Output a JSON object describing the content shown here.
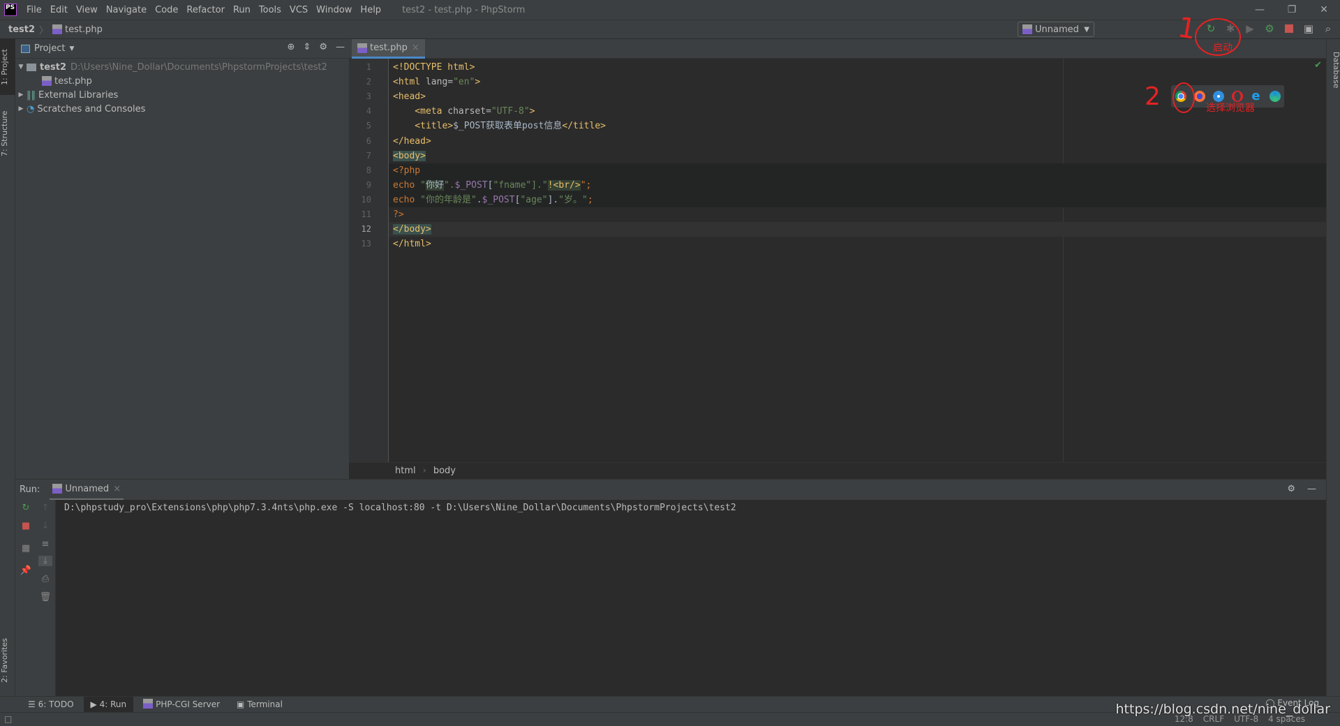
{
  "window": {
    "title": "test2 - test.php - PhpStorm",
    "logo": "PS",
    "controls": [
      "—",
      "❐",
      "✕"
    ]
  },
  "menu": [
    "File",
    "Edit",
    "View",
    "Navigate",
    "Code",
    "Refactor",
    "Run",
    "Tools",
    "VCS",
    "Window",
    "Help"
  ],
  "navbar": {
    "project": "test2",
    "file": "test.php"
  },
  "toolbar": {
    "run_config": "Unnamed",
    "icons": [
      "rerun-icon",
      "debug-icon",
      "coverage-icon",
      "profile-icon",
      "stop-icon",
      "terminal-icon",
      "search-icon"
    ]
  },
  "left_stripe": {
    "project": "1: Project",
    "structure": "7: Structure",
    "favorites": "2: Favorites"
  },
  "right_stripe": {
    "database": "Database"
  },
  "project_panel": {
    "title": "Project",
    "tree": [
      {
        "label": "test2",
        "path": "D:\\Users\\Nine_Dollar\\Documents\\PhpstormProjects\\test2"
      },
      {
        "label": "test.php"
      },
      {
        "label": "External Libraries"
      },
      {
        "label": "Scratches and Consoles"
      }
    ]
  },
  "editor": {
    "tab": "test.php",
    "current_line": 12,
    "lines": [
      [
        [
          "<!DOCTYPE html>",
          "tag"
        ]
      ],
      [
        [
          "<html ",
          "tag"
        ],
        [
          "lang=",
          "attr"
        ],
        [
          "\"en\"",
          "str"
        ],
        [
          ">",
          "tag"
        ]
      ],
      [
        [
          "<head>",
          "tag"
        ]
      ],
      [
        [
          "    <meta ",
          "tag"
        ],
        [
          "charset=",
          "attr"
        ],
        [
          "\"UTF-8\"",
          "str"
        ],
        [
          ">",
          "tag"
        ]
      ],
      [
        [
          "    <title>",
          "tag"
        ],
        [
          "$_POST获取表单post信息",
          "txt"
        ],
        [
          "</title>",
          "tag"
        ]
      ],
      [
        [
          "</head>",
          "tag"
        ]
      ],
      [
        [
          "<body>",
          "tag hlg"
        ]
      ],
      [
        [
          "<?php",
          "kw"
        ]
      ],
      [
        [
          "echo ",
          "kw"
        ],
        [
          "\"",
          "str"
        ],
        [
          "你好",
          "txt hl"
        ],
        [
          "\".",
          "str"
        ],
        [
          "$_POST",
          "var"
        ],
        [
          "[",
          "txt"
        ],
        [
          "\"fname\"",
          "str"
        ],
        [
          "].\"",
          "str"
        ],
        [
          "!<br/>",
          "tag hl"
        ],
        [
          "\";",
          "kw"
        ]
      ],
      [
        [
          "echo ",
          "kw"
        ],
        [
          "\"你的年龄是\"",
          "str"
        ],
        [
          ".",
          "txt"
        ],
        [
          "$_POST",
          "var"
        ],
        [
          "[",
          "txt"
        ],
        [
          "\"age\"",
          "str"
        ],
        [
          "].",
          "txt"
        ],
        [
          "\"岁。\"",
          "str"
        ],
        [
          ";",
          "kw"
        ]
      ],
      [
        [
          "?>",
          "kw"
        ]
      ],
      [
        [
          "</body>",
          "tag hlg"
        ]
      ],
      [
        [
          "</html>",
          "tag"
        ]
      ]
    ],
    "breadcrumbs": [
      "html",
      "body"
    ]
  },
  "browsers": [
    "chrome",
    "firefox",
    "safari",
    "opera",
    "ie",
    "edge"
  ],
  "annotations": {
    "one": "1",
    "start": "启动",
    "two": "2",
    "choose_browser": "选择浏览器"
  },
  "run_panel": {
    "label": "Run:",
    "tab": "Unnamed",
    "output": "D:\\phpstudy_pro\\Extensions\\php\\php7.3.4nts\\php.exe -S localhost:80 -t D:\\Users\\Nine_Dollar\\Documents\\PhpstormProjects\\test2"
  },
  "bottom_tabs": [
    "6: TODO",
    "4: Run",
    "PHP-CGI Server",
    "Terminal"
  ],
  "event_log": "Event Log",
  "status": {
    "position": "12:8",
    "line_sep": "CRLF",
    "encoding": "UTF-8",
    "indent": "4 spaces"
  },
  "watermark": "https://blog.csdn.net/nine_dollar"
}
